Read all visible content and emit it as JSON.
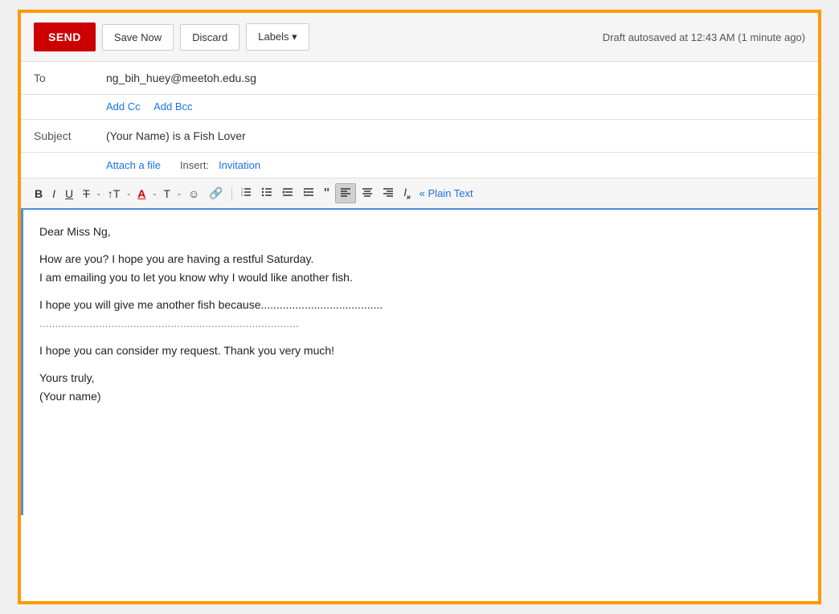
{
  "toolbar": {
    "send_label": "SEND",
    "save_now_label": "Save Now",
    "discard_label": "Discard",
    "labels_label": "Labels ▾",
    "draft_status": "Draft autosaved at 12:43 AM (1 minute ago)"
  },
  "fields": {
    "to_label": "To",
    "to_value": "ng_bih_huey@meetoh.edu.sg",
    "add_cc": "Add Cc",
    "add_bcc": "Add Bcc",
    "subject_label": "Subject",
    "subject_value": "(Your Name) is a Fish Lover",
    "attach_label": "Attach a file",
    "insert_label": "Insert:",
    "invitation_label": "Invitation"
  },
  "formatting": {
    "bold": "B",
    "italic": "I",
    "underline": "U",
    "strikethrough": "T",
    "bigger": "T↑",
    "font_color": "A",
    "text_bg": "T",
    "emoji": "☺",
    "link": "∞",
    "numbered_list": "≡",
    "bullet_list": "☰",
    "outdent": "⇤",
    "indent": "⇥",
    "quote": "❞",
    "align_left": "≡",
    "align_center": "≡",
    "align_right": "≡",
    "clear_format": "Ix",
    "plain_text": "« Plain Text"
  },
  "body": {
    "line1": "Dear Miss Ng,",
    "line2": "How are you? I hope you are having a restful Saturday.",
    "line3": "I am emailing you to let you know why I would like another fish.",
    "line4": "I hope you will give me another fish because.......................................",
    "line5": "...................................................................................",
    "line6": "I hope you can consider my request. Thank you very much!",
    "line7": "Yours truly,",
    "line8": "(Your name)"
  }
}
